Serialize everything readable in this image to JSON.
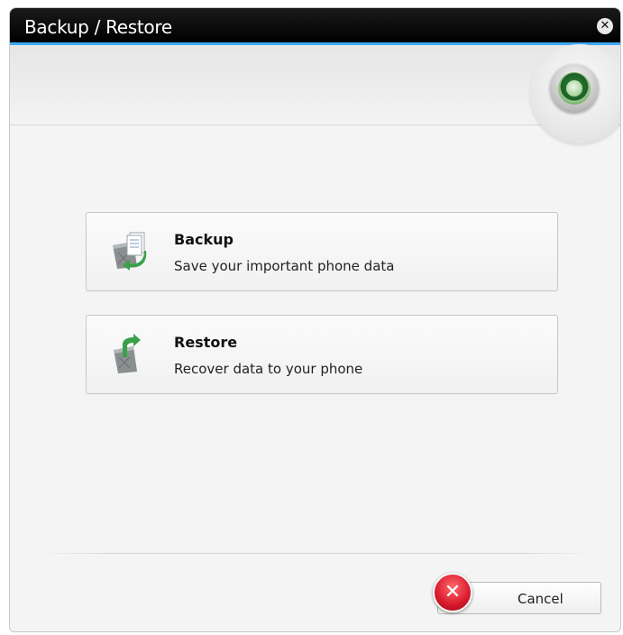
{
  "window": {
    "title": "Backup / Restore",
    "close_icon": "close-icon",
    "accent_color": "#3fa9f5"
  },
  "header": {
    "device_icon": "device-connected-icon"
  },
  "options": [
    {
      "label": "Backup",
      "description": "Save your important phone data",
      "icon": "backup-icon"
    },
    {
      "label": "Restore",
      "description": "Recover data to your phone",
      "icon": "restore-icon"
    }
  ],
  "footer": {
    "cancel_label": "Cancel",
    "cancel_icon": "cancel-x-icon",
    "cancel_icon_color": "#d8192b"
  }
}
